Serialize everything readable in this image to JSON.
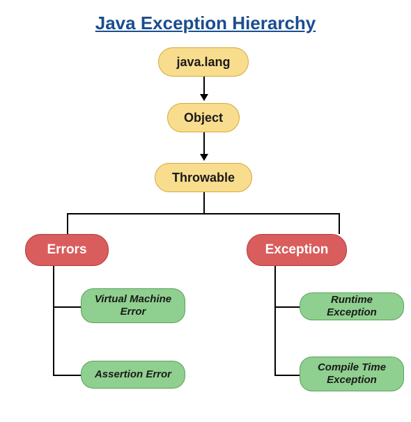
{
  "title": "Java Exception Hierarchy ",
  "nodes": {
    "javalang": "java.lang",
    "object": "Object",
    "throwable": "Throwable",
    "errors": "Errors",
    "exception": "Exception",
    "vmerror": "Virtual Machine Error",
    "assertionerror": "Assertion Error",
    "runtimeexception": "Runtime Exception",
    "compiletimeexception": "Compile Time Exception"
  }
}
